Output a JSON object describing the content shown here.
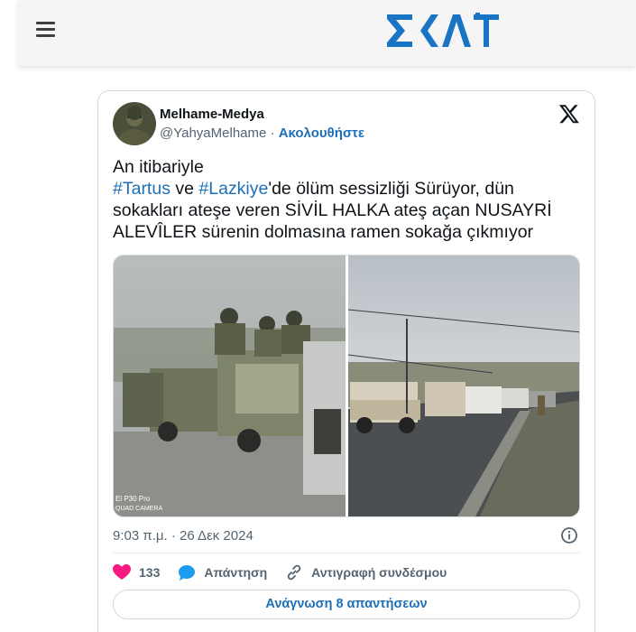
{
  "site": {
    "logo_text": "ΣΚΑΪ"
  },
  "tweet": {
    "display_name": "Melhame-Medya",
    "handle": "@YahyaMelhame",
    "separator": " · ",
    "follow_label": "Ακολουθήστε",
    "text": {
      "line1": "An itibariyle",
      "hashtag1": "#Tartus",
      "between": " ve ",
      "hashtag2": "#Lazkiye",
      "rest": "'de ölüm sessizliği Sürüyor, dün sokakları ateşe veren SİVİL HALKA ateş açan NUSAYRİ ALEVÎLER sürenin dolmasına ramen sokağa çıkmıyor"
    },
    "photo_watermark_line1": "El P30 Pro",
    "photo_watermark_line2": "QUAD CAMERA",
    "timestamp": "9:03 π.μ. · 26 Δεκ 2024",
    "like_count": "133",
    "reply_label": "Απάντηση",
    "copy_link_label": "Αντιγραφή συνδέσμου",
    "read_replies_label": "Ανάγνωση 8 απαντήσεων"
  },
  "icons": {
    "menu": "hamburger-menu-icon",
    "x": "x-logo-icon",
    "info": "info-icon",
    "like": "heart-icon",
    "reply": "speech-bubble-icon",
    "link": "link-icon"
  },
  "colors": {
    "brand_blue": "#1d6fb8",
    "skai_blue": "#1a74c4",
    "like_pink": "#f91880",
    "reply_blue": "#1d9bf0"
  }
}
